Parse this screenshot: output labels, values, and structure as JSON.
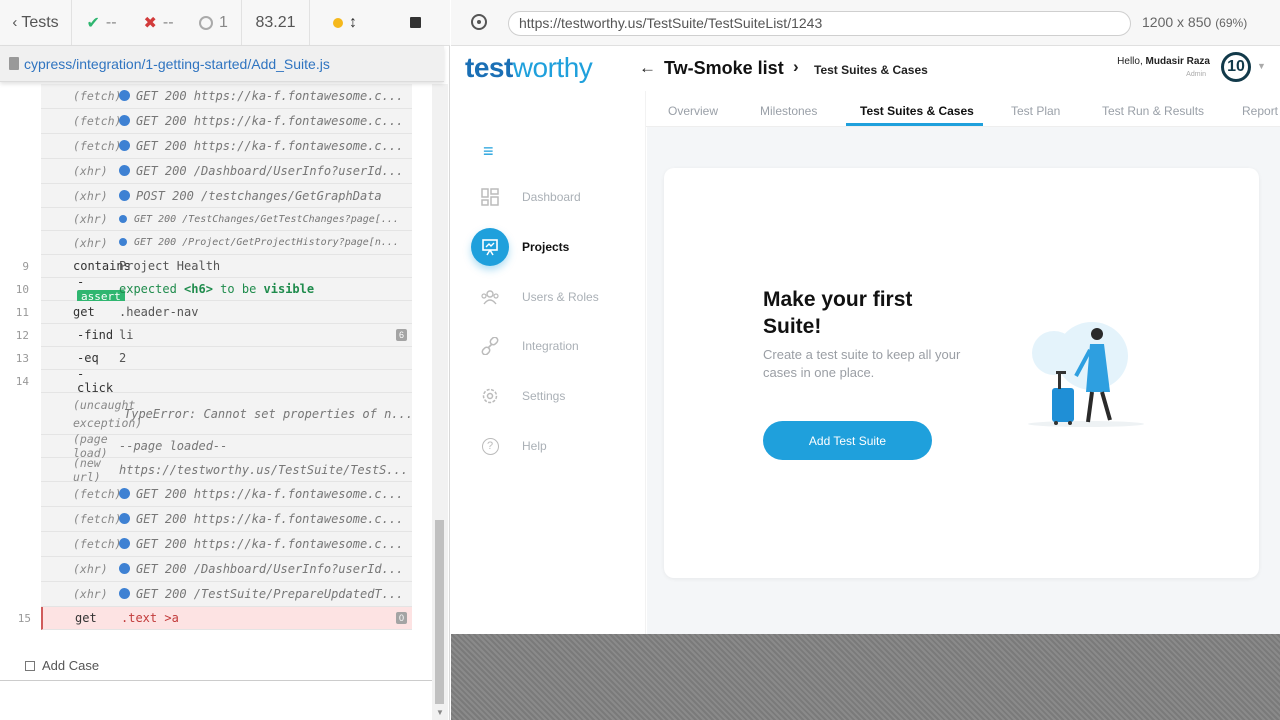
{
  "reporter": {
    "back_label": "Tests",
    "passed": "--",
    "failed": "--",
    "pending": "1",
    "duration": "83.21",
    "spec_path": "cypress/integration/1-getting-started/Add_Suite.js",
    "add_case_label": "Add Case"
  },
  "log": [
    {
      "name": "(fetch)",
      "msg": "GET 200 https://ka-f.fontawesome.c..."
    },
    {
      "name": "(fetch)",
      "msg": "GET 200 https://ka-f.fontawesome.c..."
    },
    {
      "name": "(fetch)",
      "msg": "GET 200 https://ka-f.fontawesome.c..."
    },
    {
      "name": "(xhr)",
      "msg": "GET 200 /Dashboard/UserInfo?userId..."
    },
    {
      "name": "(xhr)",
      "msg": "POST 200 /testchanges/GetGraphData"
    },
    {
      "name": "(xhr)",
      "msg": "GET 200 /TestChanges/GetTestChanges?page[..."
    },
    {
      "name": "(xhr)",
      "msg": "GET 200 /Project/GetProjectHistory?page[n..."
    },
    {
      "num": "9",
      "name": "contains",
      "msg": "Project Health"
    },
    {
      "num": "10",
      "name": "assert",
      "msg_parts": [
        "expected",
        "<h6>",
        "to be",
        "visible"
      ]
    },
    {
      "num": "11",
      "name": "get",
      "msg": ".header-nav"
    },
    {
      "num": "12",
      "name": "-find",
      "msg": "li",
      "badge": "6"
    },
    {
      "num": "13",
      "name": "-eq",
      "msg": "2"
    },
    {
      "num": "14",
      "name": "-click",
      "msg": ""
    },
    {
      "name": "(uncaught exception)",
      "msg": "TypeError: Cannot set properties of n..."
    },
    {
      "name": "(page load)",
      "msg": "--page loaded--"
    },
    {
      "name": "(new url)",
      "msg": "https://testworthy.us/TestSuite/TestS..."
    },
    {
      "name": "(fetch)",
      "msg": "GET 200 https://ka-f.fontawesome.c..."
    },
    {
      "name": "(fetch)",
      "msg": "GET 200 https://ka-f.fontawesome.c..."
    },
    {
      "name": "(fetch)",
      "msg": "GET 200 https://ka-f.fontawesome.c..."
    },
    {
      "name": "(xhr)",
      "msg": "GET 200 /Dashboard/UserInfo?userId..."
    },
    {
      "name": "(xhr)",
      "msg": "GET 200 /TestSuite/PrepareUpdatedT..."
    },
    {
      "num": "15",
      "name": "get",
      "msg": ".text >a",
      "badge": "0"
    }
  ],
  "aut": {
    "url": "https://testworthy.us/TestSuite/TestSuiteList/1243",
    "viewport": "1200 x 850",
    "zoom": "(69%)"
  },
  "app": {
    "logo_t": "test",
    "logo_w": "worthy",
    "title": "Tw-Smoke list",
    "breadcrumb": "Test Suites & Cases",
    "hello": "Hello,",
    "user_name": "Mudasir Raza",
    "role": "Admin",
    "avatar_text": "10",
    "tabs": [
      "Overview",
      "Milestones",
      "Test Suites & Cases",
      "Test Plan",
      "Test Run & Results",
      "Report"
    ],
    "sidebar": [
      "Dashboard",
      "Projects",
      "Users & Roles",
      "Integration",
      "Settings",
      "Help"
    ],
    "card_title": "Make your first Suite!",
    "card_desc": "Create a test suite to keep all your cases in one place.",
    "add_button": "Add Test Suite"
  },
  "colors": {
    "accent": "#1fa0dc",
    "pass": "#2fb670",
    "fail": "#d23b3b",
    "pin": "#f5b81c"
  }
}
